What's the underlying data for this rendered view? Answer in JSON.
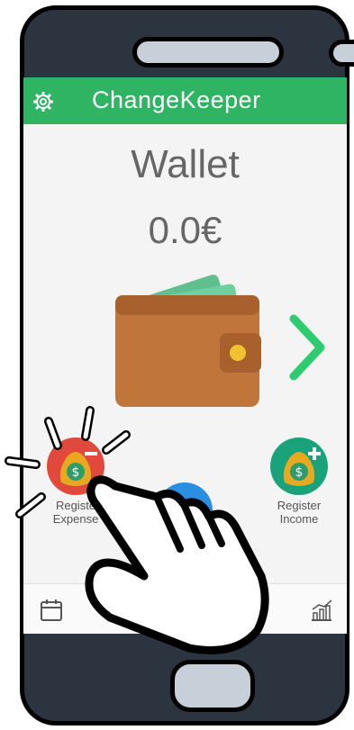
{
  "app": {
    "title": "ChangeKeeper"
  },
  "wallet": {
    "title": "Wallet",
    "balance": "0.0€"
  },
  "actions": {
    "expense": {
      "label_line1": "Registe",
      "label_line2": "Expense"
    },
    "income": {
      "label_line1": "Register",
      "label_line2": "Income"
    }
  },
  "icons": [
    "gear-icon",
    "wallet-icon",
    "chevron-right-icon",
    "money-bag-minus-icon",
    "money-bag-plus-icon",
    "calendar-icon",
    "chart-icon",
    "hand-pointer-icon"
  ],
  "colors": {
    "appbar": "#2fb463",
    "expense": "#e0493b",
    "income": "#1aa37a",
    "accent_blue": "#2a8fe0"
  }
}
